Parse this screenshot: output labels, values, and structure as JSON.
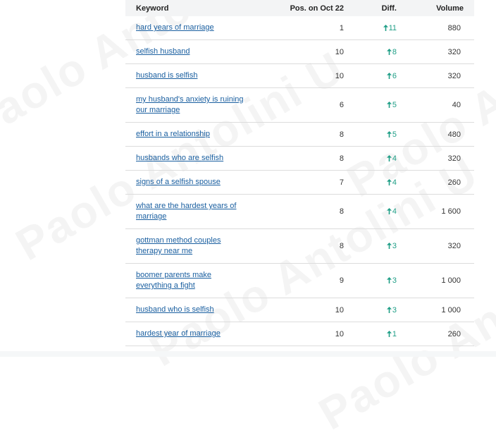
{
  "watermark": {
    "text": "Paolo Antolini U"
  },
  "table": {
    "headers": {
      "keyword": "Keyword",
      "position": "Pos. on Oct 22",
      "diff": "Diff.",
      "volume": "Volume"
    },
    "rows": [
      {
        "keyword": "hard years of marriage ",
        "position": "1",
        "diff": "11",
        "volume": "880"
      },
      {
        "keyword": "selfish husband ",
        "position": "10",
        "diff": "8",
        "volume": "320"
      },
      {
        "keyword": "husband is selfish ",
        "position": "10",
        "diff": "6",
        "volume": "320"
      },
      {
        "keyword": "my husband's anxiety is ruining our marriage ",
        "position": "6",
        "diff": "5",
        "volume": "40"
      },
      {
        "keyword": "effort in a relationship ",
        "position": "8",
        "diff": "5",
        "volume": "480"
      },
      {
        "keyword": "husbands who are selfish ",
        "position": "8",
        "diff": "4",
        "volume": "320"
      },
      {
        "keyword": "signs of a selfish spouse ",
        "position": "7",
        "diff": "4",
        "volume": "260"
      },
      {
        "keyword": "what are the hardest years of marriage ",
        "position": "8",
        "diff": "4",
        "volume": "1 600"
      },
      {
        "keyword": "gottman method couples therapy near me ",
        "position": "8",
        "diff": "3",
        "volume": "320"
      },
      {
        "keyword": "boomer parents make everything a fight ",
        "position": "9",
        "diff": "3",
        "volume": "1 000"
      },
      {
        "keyword": "husband who is selfish ",
        "position": "10",
        "diff": "3",
        "volume": "1 000"
      },
      {
        "keyword": "hardest year of marriage ",
        "position": "10",
        "diff": "1",
        "volume": "260"
      }
    ]
  },
  "colors": {
    "link": "#1a5fa0",
    "diff_up": "#1f9e86",
    "header_bg": "#f3f4f5",
    "row_border": "#dcdcdc"
  },
  "icons": {
    "diff": "arrow-up-icon"
  }
}
